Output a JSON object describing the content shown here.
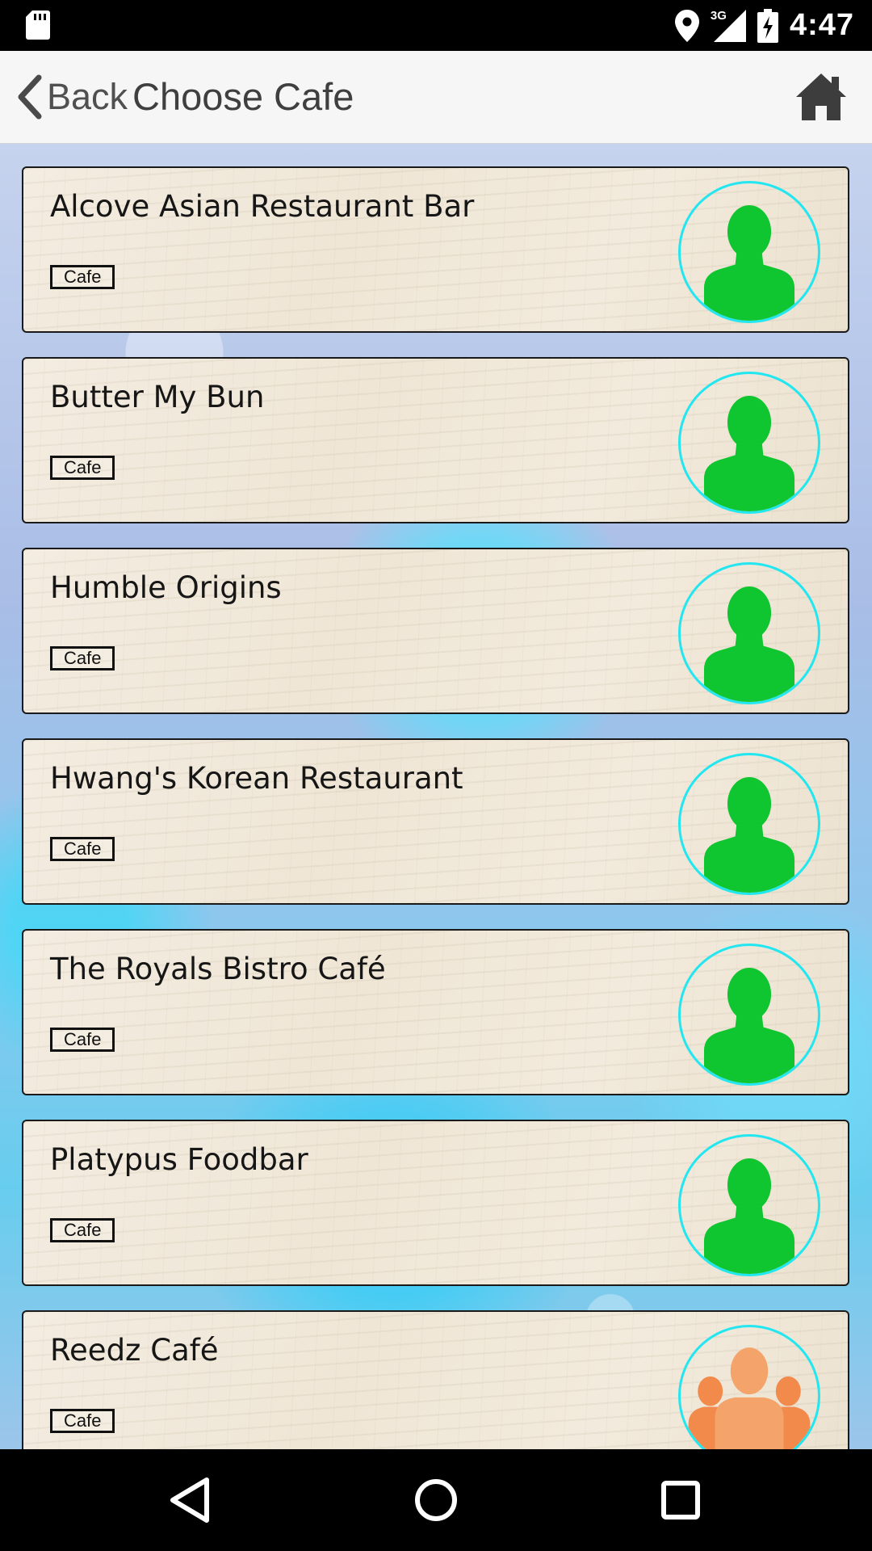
{
  "status_bar": {
    "time": "4:47",
    "network_type": "3G",
    "icons": [
      "sd-card-icon",
      "location-icon",
      "signal-icon",
      "battery-charging-icon"
    ]
  },
  "app_bar": {
    "back_label": "Back",
    "title": "Choose Cafe",
    "home_icon": "home-icon"
  },
  "cafes": [
    {
      "name": "Alcove Asian Restaurant Bar",
      "tag": "Cafe",
      "avatar": "single-person-icon"
    },
    {
      "name": "Butter My Bun",
      "tag": "Cafe",
      "avatar": "single-person-icon"
    },
    {
      "name": "Humble Origins",
      "tag": "Cafe",
      "avatar": "single-person-icon"
    },
    {
      "name": "Hwang's Korean Restaurant",
      "tag": "Cafe",
      "avatar": "single-person-icon"
    },
    {
      "name": "The Royals Bistro Café",
      "tag": "Cafe",
      "avatar": "single-person-icon"
    },
    {
      "name": "Platypus Foodbar",
      "tag": "Cafe",
      "avatar": "single-person-icon"
    },
    {
      "name": "Reedz Café",
      "tag": "Cafe",
      "avatar": "group-icon"
    }
  ],
  "colors": {
    "avatar_ring": "#22e6f0",
    "person_green": "#0fc530",
    "group_orange": "#f4935a"
  },
  "nav_bar": {
    "icons": [
      "nav-back-icon",
      "nav-home-icon",
      "nav-recents-icon"
    ]
  }
}
